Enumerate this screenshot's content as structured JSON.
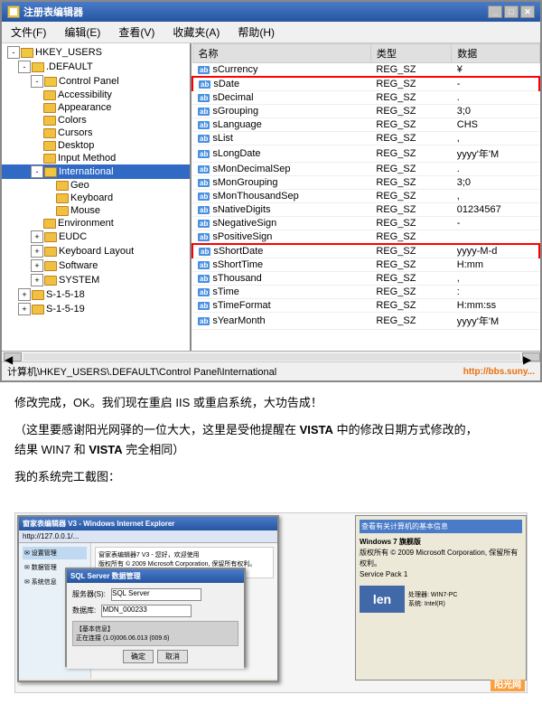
{
  "regedit": {
    "title": "注册表编辑器",
    "menus": [
      "文件(F)",
      "编辑(E)",
      "查看(V)",
      "收藏夹(A)",
      "帮助(H)"
    ],
    "tree": [
      {
        "id": "hkey_users",
        "label": "HKEY_USERS",
        "indent": 0,
        "expanded": true,
        "type": "root"
      },
      {
        "id": "default",
        "label": ".DEFAULT",
        "indent": 1,
        "expanded": true,
        "type": "folder"
      },
      {
        "id": "control_panel",
        "label": "Control Panel",
        "indent": 2,
        "expanded": true,
        "type": "folder"
      },
      {
        "id": "accessibility",
        "label": "Accessibility",
        "indent": 3,
        "expanded": false,
        "type": "folder"
      },
      {
        "id": "appearance",
        "label": "Appearance",
        "indent": 3,
        "expanded": false,
        "type": "folder"
      },
      {
        "id": "colors",
        "label": "Colors",
        "indent": 3,
        "expanded": false,
        "type": "folder"
      },
      {
        "id": "cursors",
        "label": "Cursors",
        "indent": 3,
        "expanded": false,
        "type": "folder"
      },
      {
        "id": "desktop",
        "label": "Desktop",
        "indent": 3,
        "expanded": false,
        "type": "folder"
      },
      {
        "id": "input_method",
        "label": "Input Method",
        "indent": 3,
        "expanded": false,
        "type": "folder"
      },
      {
        "id": "international",
        "label": "International",
        "indent": 3,
        "expanded": true,
        "type": "folder",
        "selected": true
      },
      {
        "id": "geo",
        "label": "Geo",
        "indent": 4,
        "expanded": false,
        "type": "folder"
      },
      {
        "id": "keyboard",
        "label": "Keyboard",
        "indent": 4,
        "expanded": false,
        "type": "folder"
      },
      {
        "id": "mouse",
        "label": "Mouse",
        "indent": 4,
        "expanded": false,
        "type": "folder"
      },
      {
        "id": "environment",
        "label": "Environment",
        "indent": 3,
        "expanded": false,
        "type": "folder"
      },
      {
        "id": "eudc",
        "label": "EUDC",
        "indent": 2,
        "expanded": false,
        "type": "folder"
      },
      {
        "id": "keyboard_layout",
        "label": "Keyboard Layout",
        "indent": 2,
        "expanded": false,
        "type": "folder"
      },
      {
        "id": "software",
        "label": "Software",
        "indent": 2,
        "expanded": false,
        "type": "folder"
      },
      {
        "id": "system",
        "label": "SYSTEM",
        "indent": 2,
        "expanded": false,
        "type": "folder"
      },
      {
        "id": "s-1-5-18",
        "label": "S-1-5-18",
        "indent": 1,
        "expanded": false,
        "type": "folder"
      },
      {
        "id": "s-1-5-19",
        "label": "S-1-5-19",
        "indent": 1,
        "expanded": false,
        "type": "folder"
      }
    ],
    "columns": [
      "名称",
      "类型",
      "数据"
    ],
    "rows": [
      {
        "name": "sCurrency",
        "type": "REG_SZ",
        "data": "¥",
        "highlighted": false
      },
      {
        "name": "sDate",
        "type": "REG_SZ",
        "data": "-",
        "highlighted": true,
        "border_red": true
      },
      {
        "name": "sDecimal",
        "type": "REG_SZ",
        "data": ".",
        "highlighted": false
      },
      {
        "name": "sGrouping",
        "type": "REG_SZ",
        "data": "3;0",
        "highlighted": false
      },
      {
        "name": "sLanguage",
        "type": "REG_SZ",
        "data": "CHS",
        "highlighted": false
      },
      {
        "name": "sList",
        "type": "REG_SZ",
        "data": ",",
        "highlighted": false
      },
      {
        "name": "sLongDate",
        "type": "REG_SZ",
        "data": "yyyy'年'M",
        "highlighted": false
      },
      {
        "name": "sMonDecimalSep",
        "type": "REG_SZ",
        "data": ".",
        "highlighted": false
      },
      {
        "name": "sMonGrouping",
        "type": "REG_SZ",
        "data": "3;0",
        "highlighted": false
      },
      {
        "name": "sMonThousandSep",
        "type": "REG_SZ",
        "data": ",",
        "highlighted": false
      },
      {
        "name": "sNativeDigits",
        "type": "REG_SZ",
        "data": "01234567",
        "highlighted": false
      },
      {
        "name": "sNegativeSign",
        "type": "REG_SZ",
        "data": "-",
        "highlighted": false
      },
      {
        "name": "sPositiveSign",
        "type": "REG_SZ",
        "data": "",
        "highlighted": false
      },
      {
        "name": "sShortDate",
        "type": "REG_SZ",
        "data": "yyyy-M-d",
        "highlighted": true,
        "border_red": true
      },
      {
        "name": "sShortTime",
        "type": "REG_SZ",
        "data": "H:mm",
        "highlighted": false
      },
      {
        "name": "sThousand",
        "type": "REG_SZ",
        "data": ",",
        "highlighted": false
      },
      {
        "name": "sTime",
        "type": "REG_SZ",
        "data": ":",
        "highlighted": false
      },
      {
        "name": "sTimeFormat",
        "type": "REG_SZ",
        "data": "H:mm:ss",
        "highlighted": false
      },
      {
        "name": "sYearMonth",
        "type": "REG_SZ",
        "data": "yyyy'年'M",
        "highlighted": false
      }
    ],
    "status_bar": "计算机\\HKEY_USERS\\.DEFAULT\\Control Panel\\International"
  },
  "article": {
    "para1": "修改完成，OK。我们现在重启 IIS 或重启系统，大功告成！",
    "para2_prefix": "（这里要感谢阳光网驿的一位大大，这里是受他提醒在 ",
    "para2_vista": "VISTA",
    "para2_middle": " 中的修改日期方式修改的，",
    "para2_suffix": "结果 WIN7 和 ",
    "para2_vista2": "VISTA",
    "para2_end": " 完全相同）",
    "para3": "我的系统完工截图："
  },
  "screenshot": {
    "title": "Windows Internet Explorer",
    "url": "http://127.0.0.1/...",
    "watermark": "阳光网"
  },
  "icons": {
    "expand": "+",
    "collapse": "-",
    "ab": "ab"
  }
}
